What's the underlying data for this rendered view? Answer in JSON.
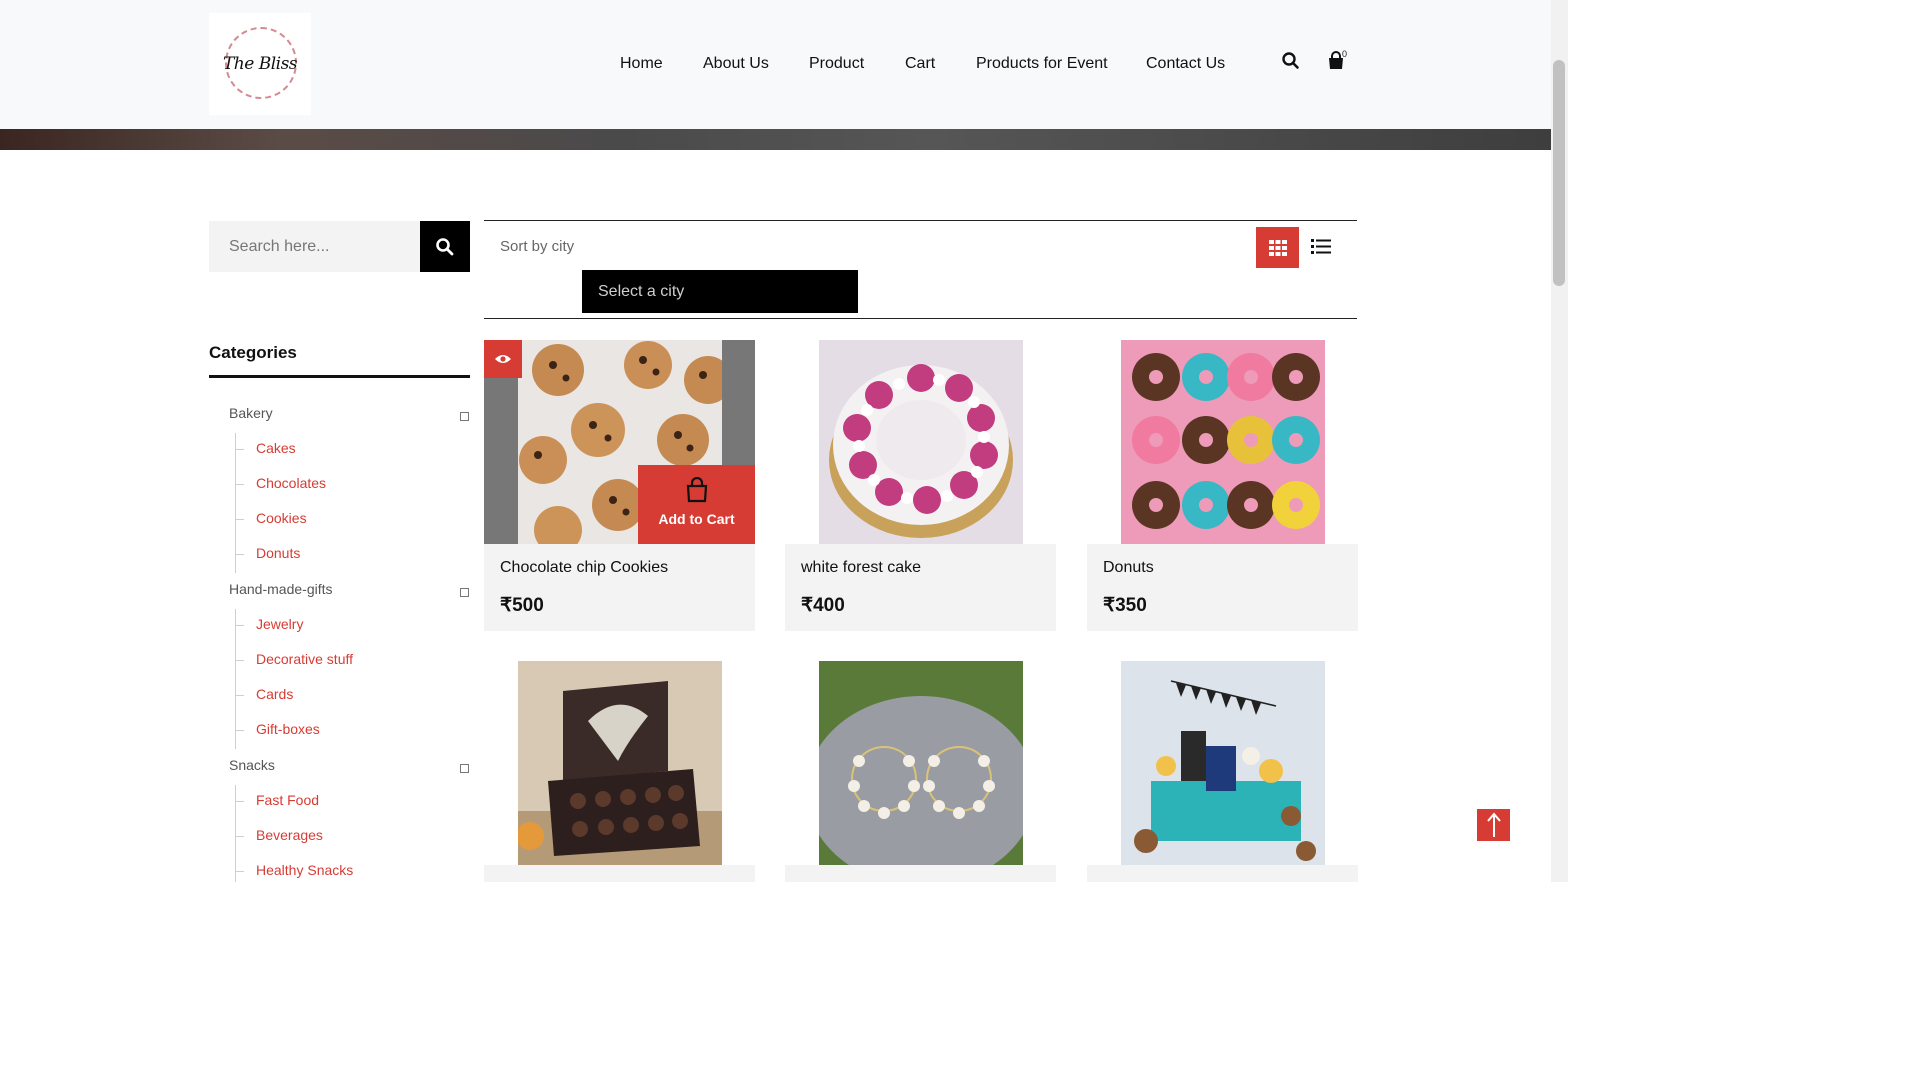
{
  "brand": {
    "logo_text": "The Bliss"
  },
  "nav": [
    {
      "label": "Home"
    },
    {
      "label": "About Us"
    },
    {
      "label": "Product"
    },
    {
      "label": "Cart"
    },
    {
      "label": "Products for Event"
    },
    {
      "label": "Contact Us"
    }
  ],
  "header": {
    "cart_count": "0",
    "icons": [
      "search-icon",
      "shopping-bag-icon"
    ]
  },
  "sidebar": {
    "search_placeholder": "Search here...",
    "categories_title": "Categories",
    "groups": [
      {
        "label": "Bakery",
        "children": [
          "Cakes",
          "Chocolates",
          "Cookies",
          "Donuts"
        ]
      },
      {
        "label": "Hand-made-gifts",
        "children": [
          "Jewelry",
          "Decorative stuff",
          "Cards",
          "Gift-boxes"
        ]
      },
      {
        "label": "Snacks",
        "children": [
          "Fast Food",
          "Beverages",
          "Healthy Snacks"
        ]
      }
    ]
  },
  "sort": {
    "label": "Sort by city",
    "city_placeholder": "Select a city",
    "views": [
      "grid-view",
      "list-view"
    ]
  },
  "products": [
    {
      "name": "Chocolate chip Cookies",
      "price": "₹500"
    },
    {
      "name": "white forest cake",
      "price": "₹400"
    },
    {
      "name": "Donuts",
      "price": "₹350"
    }
  ],
  "product_actions": {
    "add_to_cart": "Add to Cart"
  },
  "colors": {
    "accent": "#d63c34",
    "header_bg": "#f8f9fa",
    "card_bg": "#f3f3f3"
  }
}
